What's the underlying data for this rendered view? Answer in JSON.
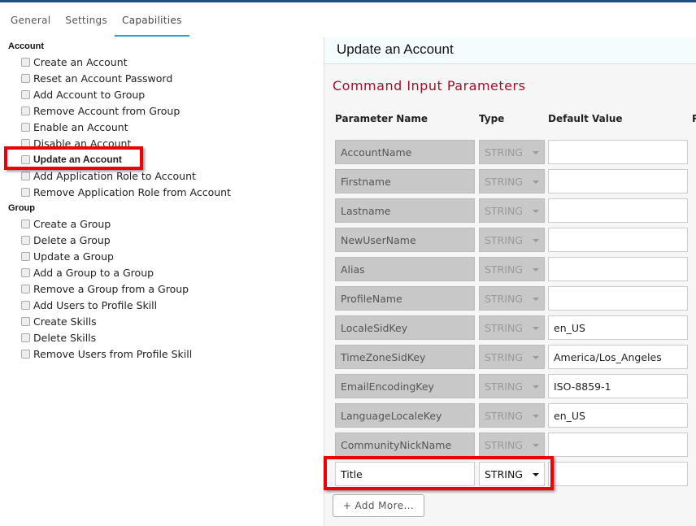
{
  "tabs": [
    "General",
    "Settings",
    "Capabilities"
  ],
  "active_tab": "Capabilities",
  "groups": [
    {
      "label": "Account",
      "items": [
        "Create an Account",
        "Reset an Account Password",
        "Add Account to Group",
        "Remove Account from Group",
        "Enable an Account",
        "Disable an Account",
        "Update an Account",
        "Add Application Role to Account",
        "Remove Application Role from Account"
      ]
    },
    {
      "label": "Group",
      "items": [
        "Create a Group",
        "Delete a Group",
        "Update a Group",
        "Add a Group to a Group",
        "Remove a Group from a Group",
        "Add Users to Profile Skill",
        "Create Skills",
        "Delete Skills",
        "Remove Users from Profile Skill"
      ]
    }
  ],
  "selected_item": "Update an Account",
  "panel": {
    "title": "Update an Account",
    "section": "Command Input Parameters",
    "columns": [
      "Parameter Name",
      "Type",
      "Default Value",
      "R"
    ],
    "rows": [
      {
        "name": "AccountName",
        "type": "STRING",
        "default": ""
      },
      {
        "name": "Firstname",
        "type": "STRING",
        "default": ""
      },
      {
        "name": "Lastname",
        "type": "STRING",
        "default": ""
      },
      {
        "name": "NewUserName",
        "type": "STRING",
        "default": ""
      },
      {
        "name": "Alias",
        "type": "STRING",
        "default": ""
      },
      {
        "name": "ProfileName",
        "type": "STRING",
        "default": ""
      },
      {
        "name": "LocaleSidKey",
        "type": "STRING",
        "default": "en_US"
      },
      {
        "name": "TimeZoneSidKey",
        "type": "STRING",
        "default": "America/Los_Angeles"
      },
      {
        "name": "EmailEncodingKey",
        "type": "STRING",
        "default": "ISO-8859-1"
      },
      {
        "name": "LanguageLocaleKey",
        "type": "STRING",
        "default": "en_US"
      },
      {
        "name": "CommunityNickName",
        "type": "STRING",
        "default": ""
      },
      {
        "name": "Title",
        "type": "STRING",
        "default": "",
        "editable": true
      }
    ],
    "add_more": "+  Add More..."
  },
  "colors": {
    "accent": "#2a9fd6",
    "section_title": "#a0102a",
    "highlight": "#ee0000"
  }
}
